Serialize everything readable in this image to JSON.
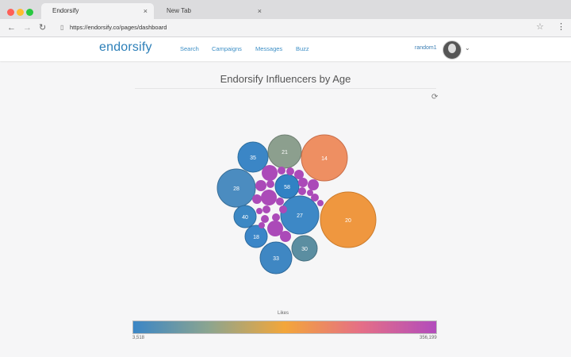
{
  "browser": {
    "tabs": [
      {
        "label": "Endorsify",
        "close": "×"
      },
      {
        "label": "New Tab",
        "close": "×"
      }
    ],
    "url": "https://endorsify.co/pages/dashboard",
    "icons": [
      "back-icon",
      "forward-icon",
      "reload-icon",
      "page-icon",
      "star-icon",
      "menu-icon"
    ]
  },
  "header": {
    "logo": "endorsify",
    "nav": [
      "Search",
      "Campaigns",
      "Messages",
      "Buzz"
    ],
    "username": "random1"
  },
  "chart": {
    "title": "Endorsify Influencers by Age",
    "legend_title": "Likes",
    "legend_min": "3,518",
    "legend_max": "356,199"
  },
  "chart_data": {
    "type": "bubble",
    "title": "Endorsify Influencers by Age",
    "legend": {
      "label": "Likes",
      "min": 3518,
      "max": 356199,
      "colors": [
        "#3b86c6",
        "#8ca58f",
        "#f3a63a",
        "#e56f86",
        "#b24cbc"
      ]
    },
    "labeled_bubbles": [
      {
        "label": "35",
        "color": "#3b86c6"
      },
      {
        "label": "21",
        "color": "#8c9f8e"
      },
      {
        "label": "14",
        "color": "#ee8f62"
      },
      {
        "label": "28",
        "color": "#4b8cc0"
      },
      {
        "label": "58",
        "color": "#3182c4"
      },
      {
        "label": "40",
        "color": "#3c88c4"
      },
      {
        "label": "27",
        "color": "#3d88c6"
      },
      {
        "label": "20",
        "color": "#ef973f"
      },
      {
        "label": "18",
        "color": "#3b86c8"
      },
      {
        "label": "30",
        "color": "#5b8ea1"
      },
      {
        "label": "33",
        "color": "#3f87c3"
      }
    ],
    "unlabeled_bubbles_color": "#ab4ab8"
  }
}
